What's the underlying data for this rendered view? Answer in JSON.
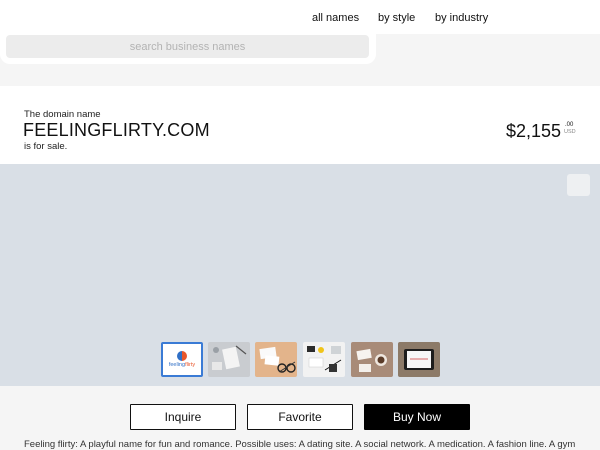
{
  "nav": {
    "all_names": "all names",
    "by_style": "by style",
    "by_industry": "by industry"
  },
  "search": {
    "placeholder": "search business names",
    "value": ""
  },
  "listing": {
    "eyebrow": "The domain name",
    "domain": "FEELINGFLIRTY.COM",
    "for_sale": "is for sale.",
    "price": "$2,155",
    "cents": ".00",
    "currency": "USD"
  },
  "gallery": {
    "logo_word_a": "feeling",
    "logo_word_b": "flirty",
    "thumbnails": [
      {
        "name": "logo",
        "selected": true
      },
      {
        "name": "business-card-desk",
        "selected": false
      },
      {
        "name": "cards-with-glasses",
        "selected": false
      },
      {
        "name": "stationery-flatlay",
        "selected": false
      },
      {
        "name": "coffee-and-card",
        "selected": false
      },
      {
        "name": "tablet-mockup",
        "selected": false
      }
    ]
  },
  "actions": {
    "inquire": "Inquire",
    "favorite": "Favorite",
    "buy_now": "Buy Now"
  },
  "description": "Feeling flirty: A playful name for fun and romance. Possible uses: A dating site. A social network. A medication. A fashion line. A gym"
}
